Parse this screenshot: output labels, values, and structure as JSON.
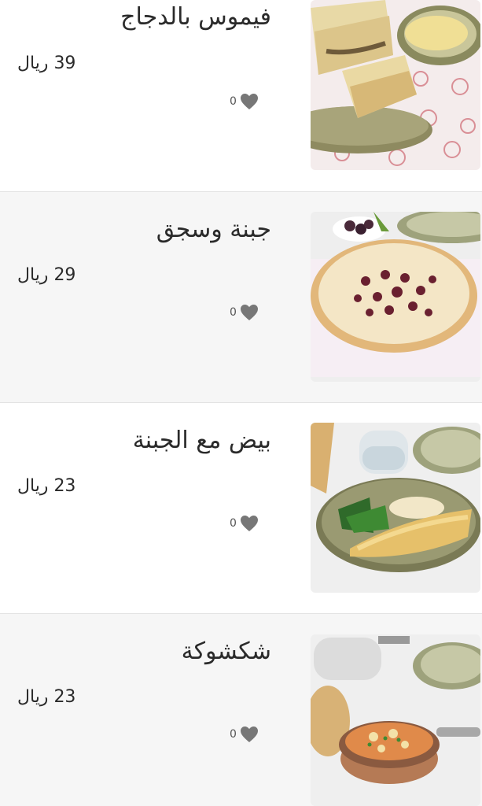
{
  "menu": {
    "items": [
      {
        "name": "فيموس بالدجاج",
        "price": "39 ريال",
        "likes": "0",
        "photo": "chicken-fimos-wrap-photo"
      },
      {
        "name": "جبنة وسجق",
        "price": "29 ريال",
        "likes": "0",
        "photo": "cheese-sausage-pie-photo"
      },
      {
        "name": "بيض مع الجبنة",
        "price": "23 ريال",
        "likes": "0",
        "photo": "eggs-with-cheese-photo"
      },
      {
        "name": "شكشوكة",
        "price": "23 ريال",
        "likes": "0",
        "photo": "shakshuka-photo"
      }
    ],
    "icons": {
      "like": "heart-icon"
    },
    "colors": {
      "heart": "#777777",
      "divider": "#e3e3e3",
      "alt_row": "#f6f6f6"
    }
  }
}
